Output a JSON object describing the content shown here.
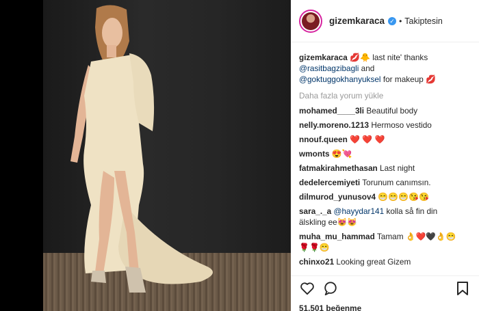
{
  "post": {
    "username": "gizemkaraca",
    "separator": "•",
    "follow_status": "Takiptesin",
    "caption": {
      "username": "gizemkaraca",
      "emoji": "💋🐥",
      "text": "last nite' thanks",
      "mention1": "@rasitbagzibagli",
      "and": "and",
      "mention2": "@goktuggokhanyuksel",
      "tail": "for makeup",
      "tail_emoji": "💋"
    },
    "load_more": "Daha fazla yorum yükle",
    "comments": [
      {
        "name": "mohamed____3li",
        "text": "Beautiful body"
      },
      {
        "name": "nelly.moreno.1213",
        "text": "Hermoso vestido"
      },
      {
        "name": "nnouf.queen",
        "text": "❤️ ❤️ ❤️"
      },
      {
        "name": "wmonts",
        "text": "😍💘"
      },
      {
        "name": "fatmakirahmethasan",
        "text": "Last night"
      },
      {
        "name": "dedelercemiyeti",
        "text": "Torunum canımsın."
      },
      {
        "name": "dilmurod_yunusov4",
        "text": "😁😁😁😘😘"
      },
      {
        "name": "sara_._a",
        "mention": "@hayydar141",
        "text": "kolla så fin din"
      },
      {
        "name": "",
        "text": "älskling ee😻😻"
      },
      {
        "name": "muha_mu_hammad",
        "text": "Tamam 👌❤️🖤👌😁"
      },
      {
        "name": "",
        "text": "🌹🌹😁"
      },
      {
        "name": "chinxo21",
        "text": "Looking great Gizem"
      }
    ],
    "likes": "51.501 beğenme"
  },
  "icons": {
    "heart": "heart-icon",
    "comment": "comment-icon",
    "bookmark": "bookmark-icon",
    "verified": "verified-badge-icon"
  },
  "colors": {
    "link": "#003569",
    "verified": "#3897f0",
    "muted": "#999999"
  }
}
